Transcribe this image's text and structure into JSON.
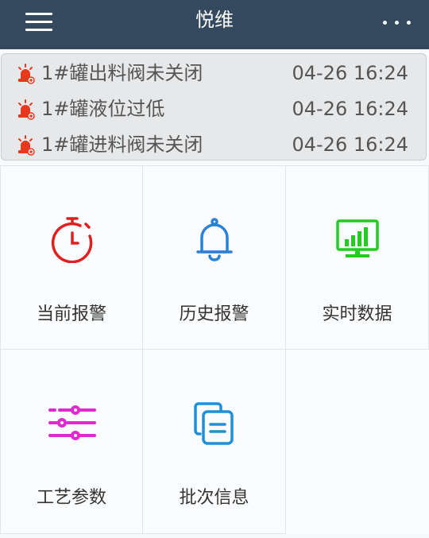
{
  "header": {
    "title": "悦维",
    "menu_icon": "hamburger-menu-icon",
    "more_icon": "more-dots-icon"
  },
  "alarms": [
    {
      "message": "1#罐出料阀未关闭",
      "time": "04-26 16:24",
      "icon": "siren-icon"
    },
    {
      "message": "1#罐液位过低",
      "time": "04-26 16:24",
      "icon": "siren-icon"
    },
    {
      "message": "1#罐进料阀未关闭",
      "time": "04-26 16:24",
      "icon": "siren-icon"
    }
  ],
  "menu": {
    "items": [
      {
        "label": "当前报警",
        "icon": "stopwatch-icon",
        "color": "#e02020"
      },
      {
        "label": "历史报警",
        "icon": "bell-icon",
        "color": "#2a82d6"
      },
      {
        "label": "实时数据",
        "icon": "monitor-chart-icon",
        "color": "#22cc22"
      },
      {
        "label": "工艺参数",
        "icon": "sliders-icon",
        "color": "#e02ad0"
      },
      {
        "label": "批次信息",
        "icon": "documents-icon",
        "color": "#1f8fd8"
      }
    ]
  },
  "colors": {
    "header_bg": "#34495e",
    "alarm_icon": "#e8391f"
  }
}
